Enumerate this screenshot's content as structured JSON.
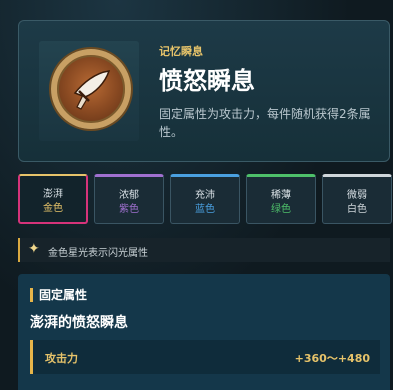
{
  "header": {
    "subtitle": "记忆瞬息",
    "title": "愤怒瞬息",
    "description": "固定属性为攻击力，每件随机获得2条属性。",
    "icon": "sword-medal-icon"
  },
  "tabs": [
    {
      "name": "澎湃",
      "quality": "金色",
      "accent": "#e6c36a",
      "active": true
    },
    {
      "name": "浓郁",
      "quality": "紫色",
      "accent": "#a070d0",
      "active": false
    },
    {
      "name": "充沛",
      "quality": "蓝色",
      "accent": "#4aa0e0",
      "active": false
    },
    {
      "name": "稀薄",
      "quality": "绿色",
      "accent": "#4ec06a",
      "active": false
    },
    {
      "name": "微弱",
      "quality": "白色",
      "accent": "#cfd6da",
      "active": false
    }
  ],
  "hint": {
    "icon": "sparkle-star-icon",
    "text": "金色星光表示闪光属性"
  },
  "fixed": {
    "section_title": "固定属性",
    "item_name": "澎湃的愤怒瞬息",
    "stat_label": "攻击力",
    "stat_value": "+360～+480"
  }
}
